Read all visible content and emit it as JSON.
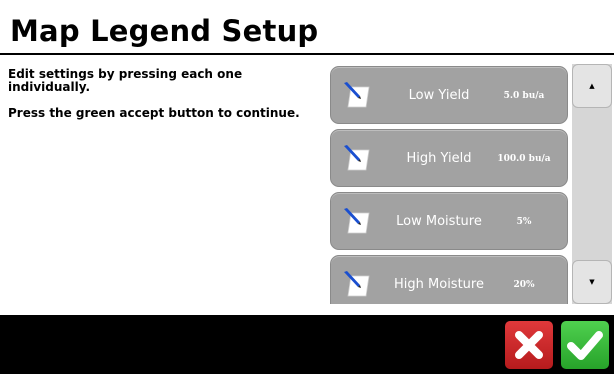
{
  "screen": {
    "title": "Map Legend Setup",
    "instructions": [
      "Edit settings by pressing each one individually.",
      "Press the green accept button to continue."
    ]
  },
  "legend_items": [
    {
      "label": "Low Yield",
      "value": "5.0 bu/a",
      "icon": "edit-note-icon"
    },
    {
      "label": "High Yield",
      "value": "100.0 bu/a",
      "icon": "edit-note-icon"
    },
    {
      "label": "Low Moisture",
      "value": "5%",
      "icon": "edit-note-icon"
    },
    {
      "label": "High Moisture",
      "value": "20%",
      "icon": "edit-note-icon"
    }
  ],
  "scrollbar": {
    "up_glyph": "▲",
    "down_glyph": "▼"
  },
  "actions": {
    "cancel": {
      "icon": "close-icon",
      "color": "#d32f2f"
    },
    "accept": {
      "icon": "checkmark-icon",
      "color": "#3cc13c"
    }
  }
}
